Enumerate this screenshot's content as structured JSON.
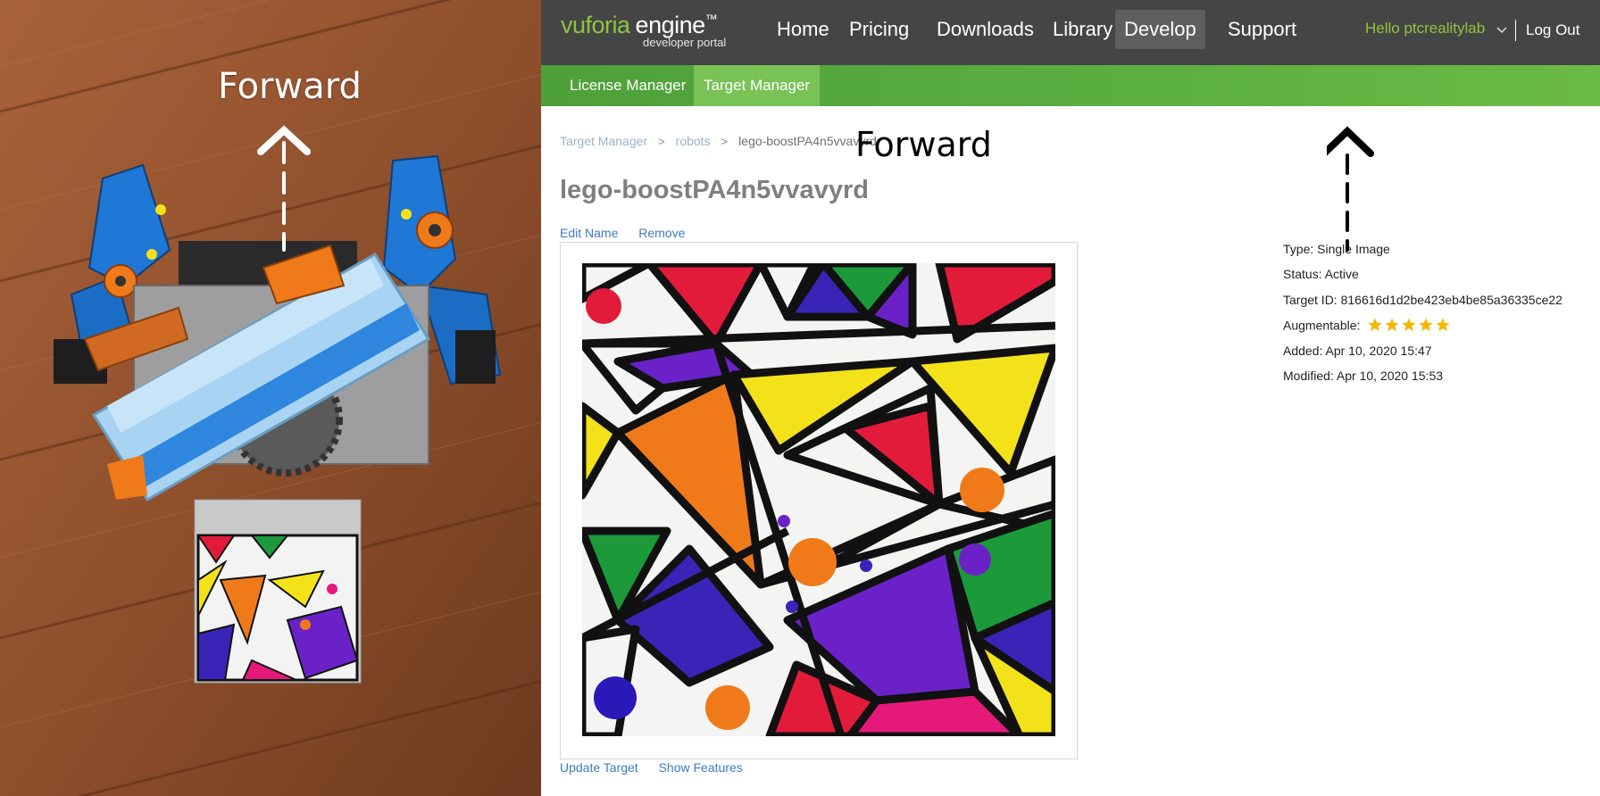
{
  "photo": {
    "forward_label": "Forward"
  },
  "overlay": {
    "forward_label": "Forward"
  },
  "header": {
    "brand_word": "vuforia",
    "brand_suffix": "engine",
    "brand_tm": "™",
    "brand_sub": "developer portal",
    "nav": [
      {
        "label": "Home"
      },
      {
        "label": "Pricing"
      },
      {
        "label": "Downloads"
      },
      {
        "label": "Library"
      },
      {
        "label": "Develop"
      },
      {
        "label": "Support"
      }
    ],
    "active_nav": "Develop",
    "user": "Hello ptcrealitylab",
    "logout": "Log Out"
  },
  "subnav": {
    "items": [
      {
        "label": "License Manager"
      },
      {
        "label": "Target Manager"
      }
    ],
    "active": "Target Manager"
  },
  "breadcrumb": {
    "items": [
      "Target Manager",
      "robots"
    ],
    "current": "lego-boostPA4n5vvavyrd",
    "separator": ">"
  },
  "target": {
    "title": "lego-boostPA4n5vvavyrd",
    "edit_name": "Edit Name",
    "remove": "Remove",
    "update_target": "Update Target",
    "show_features": "Show Features"
  },
  "meta": {
    "type": "Type: Single Image",
    "status": "Status: Active",
    "target_id": "Target ID: 816616d1d2be423eb4be85a36335ce22",
    "augmentable_label": "Augmentable:",
    "augmentable_stars": 5,
    "added": "Added: Apr 10, 2020 15:47",
    "modified": "Modified: Apr 10, 2020 15:53"
  },
  "colors": {
    "nav_bg": "#454545",
    "brand_green": "#8cc63f",
    "subnav_green": "#5cb041",
    "link_blue": "#3b7cc0",
    "star_gold": "#f5b800"
  }
}
